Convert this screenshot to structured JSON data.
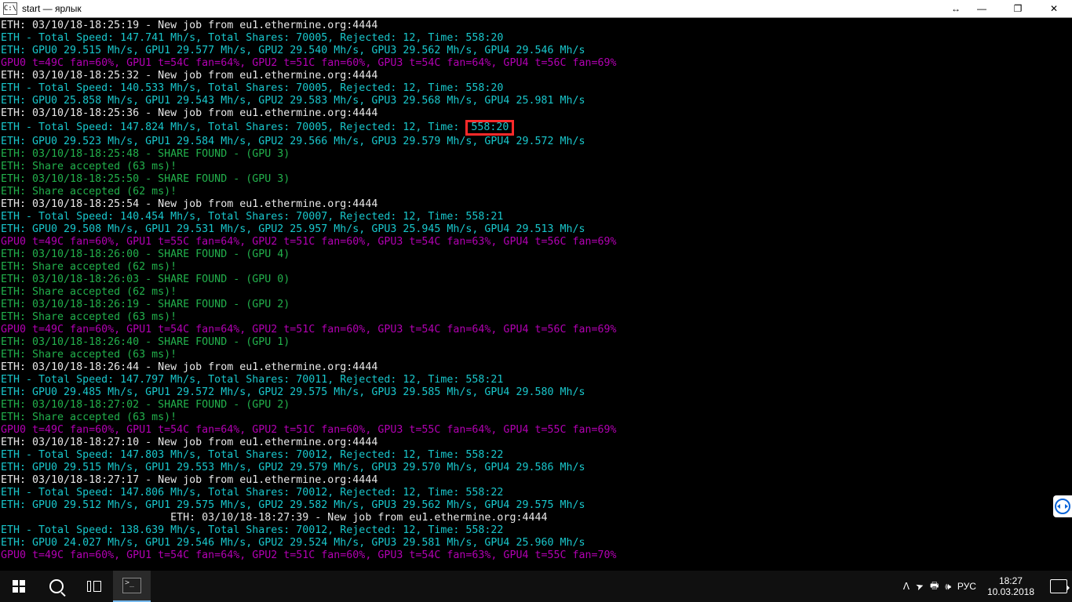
{
  "window": {
    "icon_text": "C:\\",
    "title": "start — ярлык",
    "resize_glyph": "↔",
    "min_glyph": "—",
    "max_glyph": "❐",
    "close_glyph": "✕"
  },
  "highlight_value": "558:20",
  "lines": [
    {
      "cls": "w",
      "t": "ETH: 03/10/18-18:25:19 - New job from eu1.ethermine.org:4444"
    },
    {
      "cls": "c",
      "t": "ETH - Total Speed: 147.741 Mh/s, Total Shares: 70005, Rejected: 12, Time: 558:20"
    },
    {
      "cls": "c",
      "t": "ETH: GPU0 29.515 Mh/s, GPU1 29.577 Mh/s, GPU2 29.540 Mh/s, GPU3 29.562 Mh/s, GPU4 29.546 Mh/s"
    },
    {
      "cls": "m",
      "t": "GPU0 t=49C fan=60%, GPU1 t=54C fan=64%, GPU2 t=51C fan=60%, GPU3 t=54C fan=64%, GPU4 t=56C fan=69%"
    },
    {
      "cls": "w",
      "t": "ETH: 03/10/18-18:25:32 - New job from eu1.ethermine.org:4444"
    },
    {
      "cls": "c",
      "t": "ETH - Total Speed: 140.533 Mh/s, Total Shares: 70005, Rejected: 12, Time: 558:20"
    },
    {
      "cls": "c",
      "t": "ETH: GPU0 25.858 Mh/s, GPU1 29.543 Mh/s, GPU2 29.583 Mh/s, GPU3 29.568 Mh/s, GPU4 25.981 Mh/s"
    },
    {
      "cls": "w",
      "t": "ETH: 03/10/18-18:25:36 - New job from eu1.ethermine.org:4444"
    },
    {
      "cls": "c",
      "t": "ETH - Total Speed: 147.824 Mh/s, Total Shares: 70005, Rejected: 12, Time:",
      "highlight": true
    },
    {
      "cls": "c",
      "t": "ETH: GPU0 29.523 Mh/s, GPU1 29.584 Mh/s, GPU2 29.566 Mh/s, GPU3 29.579 Mh/s, GPU4 29.572 Mh/s"
    },
    {
      "cls": "g",
      "t": "ETH: 03/10/18-18:25:48 - SHARE FOUND - (GPU 3)"
    },
    {
      "cls": "g",
      "t": "ETH: Share accepted (63 ms)!"
    },
    {
      "cls": "g",
      "t": "ETH: 03/10/18-18:25:50 - SHARE FOUND - (GPU 3)"
    },
    {
      "cls": "g",
      "t": "ETH: Share accepted (62 ms)!"
    },
    {
      "cls": "w",
      "t": "ETH: 03/10/18-18:25:54 - New job from eu1.ethermine.org:4444"
    },
    {
      "cls": "c",
      "t": "ETH - Total Speed: 140.454 Mh/s, Total Shares: 70007, Rejected: 12, Time: 558:21"
    },
    {
      "cls": "c",
      "t": "ETH: GPU0 29.508 Mh/s, GPU1 29.531 Mh/s, GPU2 25.957 Mh/s, GPU3 25.945 Mh/s, GPU4 29.513 Mh/s"
    },
    {
      "cls": "m",
      "t": "GPU0 t=49C fan=60%, GPU1 t=55C fan=64%, GPU2 t=51C fan=60%, GPU3 t=54C fan=63%, GPU4 t=56C fan=69%"
    },
    {
      "cls": "g",
      "t": "ETH: 03/10/18-18:26:00 - SHARE FOUND - (GPU 4)"
    },
    {
      "cls": "g",
      "t": "ETH: Share accepted (62 ms)!"
    },
    {
      "cls": "g",
      "t": "ETH: 03/10/18-18:26:03 - SHARE FOUND - (GPU 0)"
    },
    {
      "cls": "g",
      "t": "ETH: Share accepted (62 ms)!"
    },
    {
      "cls": "g",
      "t": "ETH: 03/10/18-18:26:19 - SHARE FOUND - (GPU 2)"
    },
    {
      "cls": "g",
      "t": "ETH: Share accepted (63 ms)!"
    },
    {
      "cls": "m",
      "t": "GPU0 t=49C fan=60%, GPU1 t=54C fan=64%, GPU2 t=51C fan=60%, GPU3 t=54C fan=64%, GPU4 t=56C fan=69%"
    },
    {
      "cls": "g",
      "t": "ETH: 03/10/18-18:26:40 - SHARE FOUND - (GPU 1)"
    },
    {
      "cls": "g",
      "t": "ETH: Share accepted (63 ms)!"
    },
    {
      "cls": "w",
      "t": "ETH: 03/10/18-18:26:44 - New job from eu1.ethermine.org:4444"
    },
    {
      "cls": "c",
      "t": "ETH - Total Speed: 147.797 Mh/s, Total Shares: 70011, Rejected: 12, Time: 558:21"
    },
    {
      "cls": "c",
      "t": "ETH: GPU0 29.485 Mh/s, GPU1 29.572 Mh/s, GPU2 29.575 Mh/s, GPU3 29.585 Mh/s, GPU4 29.580 Mh/s"
    },
    {
      "cls": "g",
      "t": "ETH: 03/10/18-18:27:02 - SHARE FOUND - (GPU 2)"
    },
    {
      "cls": "g",
      "t": "ETH: Share accepted (63 ms)!"
    },
    {
      "cls": "m",
      "t": "GPU0 t=49C fan=60%, GPU1 t=54C fan=64%, GPU2 t=51C fan=60%, GPU3 t=55C fan=64%, GPU4 t=55C fan=69%"
    },
    {
      "cls": "w",
      "t": "ETH: 03/10/18-18:27:10 - New job from eu1.ethermine.org:4444"
    },
    {
      "cls": "c",
      "t": "ETH - Total Speed: 147.803 Mh/s, Total Shares: 70012, Rejected: 12, Time: 558:22"
    },
    {
      "cls": "c",
      "t": "ETH: GPU0 29.515 Mh/s, GPU1 29.553 Mh/s, GPU2 29.579 Mh/s, GPU3 29.570 Mh/s, GPU4 29.586 Mh/s"
    },
    {
      "cls": "w",
      "t": "ETH: 03/10/18-18:27:17 - New job from eu1.ethermine.org:4444"
    },
    {
      "cls": "c",
      "t": "ETH - Total Speed: 147.806 Mh/s, Total Shares: 70012, Rejected: 12, Time: 558:22"
    },
    {
      "cls": "c",
      "t": "ETH: GPU0 29.512 Mh/s, GPU1 29.575 Mh/s, GPU2 29.582 Mh/s, GPU3 29.562 Mh/s, GPU4 29.575 Mh/s"
    },
    {
      "cls": "w",
      "t": "                           ETH: 03/10/18-18:27:39 - New job from eu1.ethermine.org:4444"
    },
    {
      "cls": "c",
      "t": "ETH - Total Speed: 138.639 Mh/s, Total Shares: 70012, Rejected: 12, Time: 558:22"
    },
    {
      "cls": "c",
      "t": "ETH: GPU0 24.027 Mh/s, GPU1 29.546 Mh/s, GPU2 29.524 Mh/s, GPU3 29.581 Mh/s, GPU4 25.960 Mh/s"
    },
    {
      "cls": "m",
      "t": "GPU0 t=49C fan=60%, GPU1 t=54C fan=64%, GPU2 t=51C fan=60%, GPU3 t=54C fan=63%, GPU4 t=55C fan=70%"
    }
  ],
  "tray": {
    "chevron": "ᐱ",
    "paper_plane": "➤",
    "printer": "🖶",
    "speaker": "🕪",
    "lang": "РУС",
    "time": "18:27",
    "date": "10.03.2018"
  }
}
